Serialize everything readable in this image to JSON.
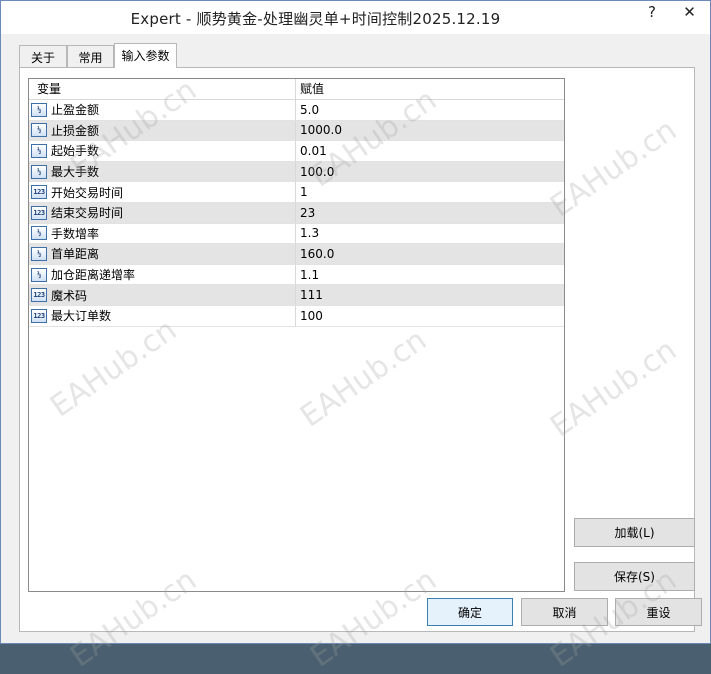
{
  "window": {
    "title": "Expert - 顺势黄金-处理幽灵单+时间控制2025.12.19",
    "help_glyph": "?",
    "close_glyph": "✕"
  },
  "tabs": [
    {
      "label": "关于",
      "active": false
    },
    {
      "label": "常用",
      "active": false
    },
    {
      "label": "输入参数",
      "active": true
    }
  ],
  "grid": {
    "headers": {
      "variable": "变量",
      "value": "赋值"
    },
    "rows": [
      {
        "name": "止盈金额",
        "value": "5.0",
        "type_icon": "double-icon",
        "icon_text": "½"
      },
      {
        "name": "止损金额",
        "value": "1000.0",
        "type_icon": "double-icon",
        "icon_text": "½"
      },
      {
        "name": "起始手数",
        "value": "0.01",
        "type_icon": "double-icon",
        "icon_text": "½"
      },
      {
        "name": "最大手数",
        "value": "100.0",
        "type_icon": "double-icon",
        "icon_text": "½"
      },
      {
        "name": "开始交易时间",
        "value": "1",
        "type_icon": "integer-icon",
        "icon_text": "123"
      },
      {
        "name": "结束交易时间",
        "value": "23",
        "type_icon": "integer-icon",
        "icon_text": "123"
      },
      {
        "name": "手数增率",
        "value": "1.3",
        "type_icon": "double-icon",
        "icon_text": "½"
      },
      {
        "name": "首单距离",
        "value": "160.0",
        "type_icon": "double-icon",
        "icon_text": "½"
      },
      {
        "name": "加仓距离递增率",
        "value": "1.1",
        "type_icon": "double-icon",
        "icon_text": "½"
      },
      {
        "name": "魔术码",
        "value": "111",
        "type_icon": "integer-icon",
        "icon_text": "123"
      },
      {
        "name": "最大订单数",
        "value": "100",
        "type_icon": "integer-icon",
        "icon_text": "123"
      }
    ]
  },
  "buttons": {
    "load": "加载(L)",
    "save": "保存(S)",
    "ok": "确定",
    "cancel": "取消",
    "reset": "重设"
  },
  "watermark": "EAHub.cn"
}
